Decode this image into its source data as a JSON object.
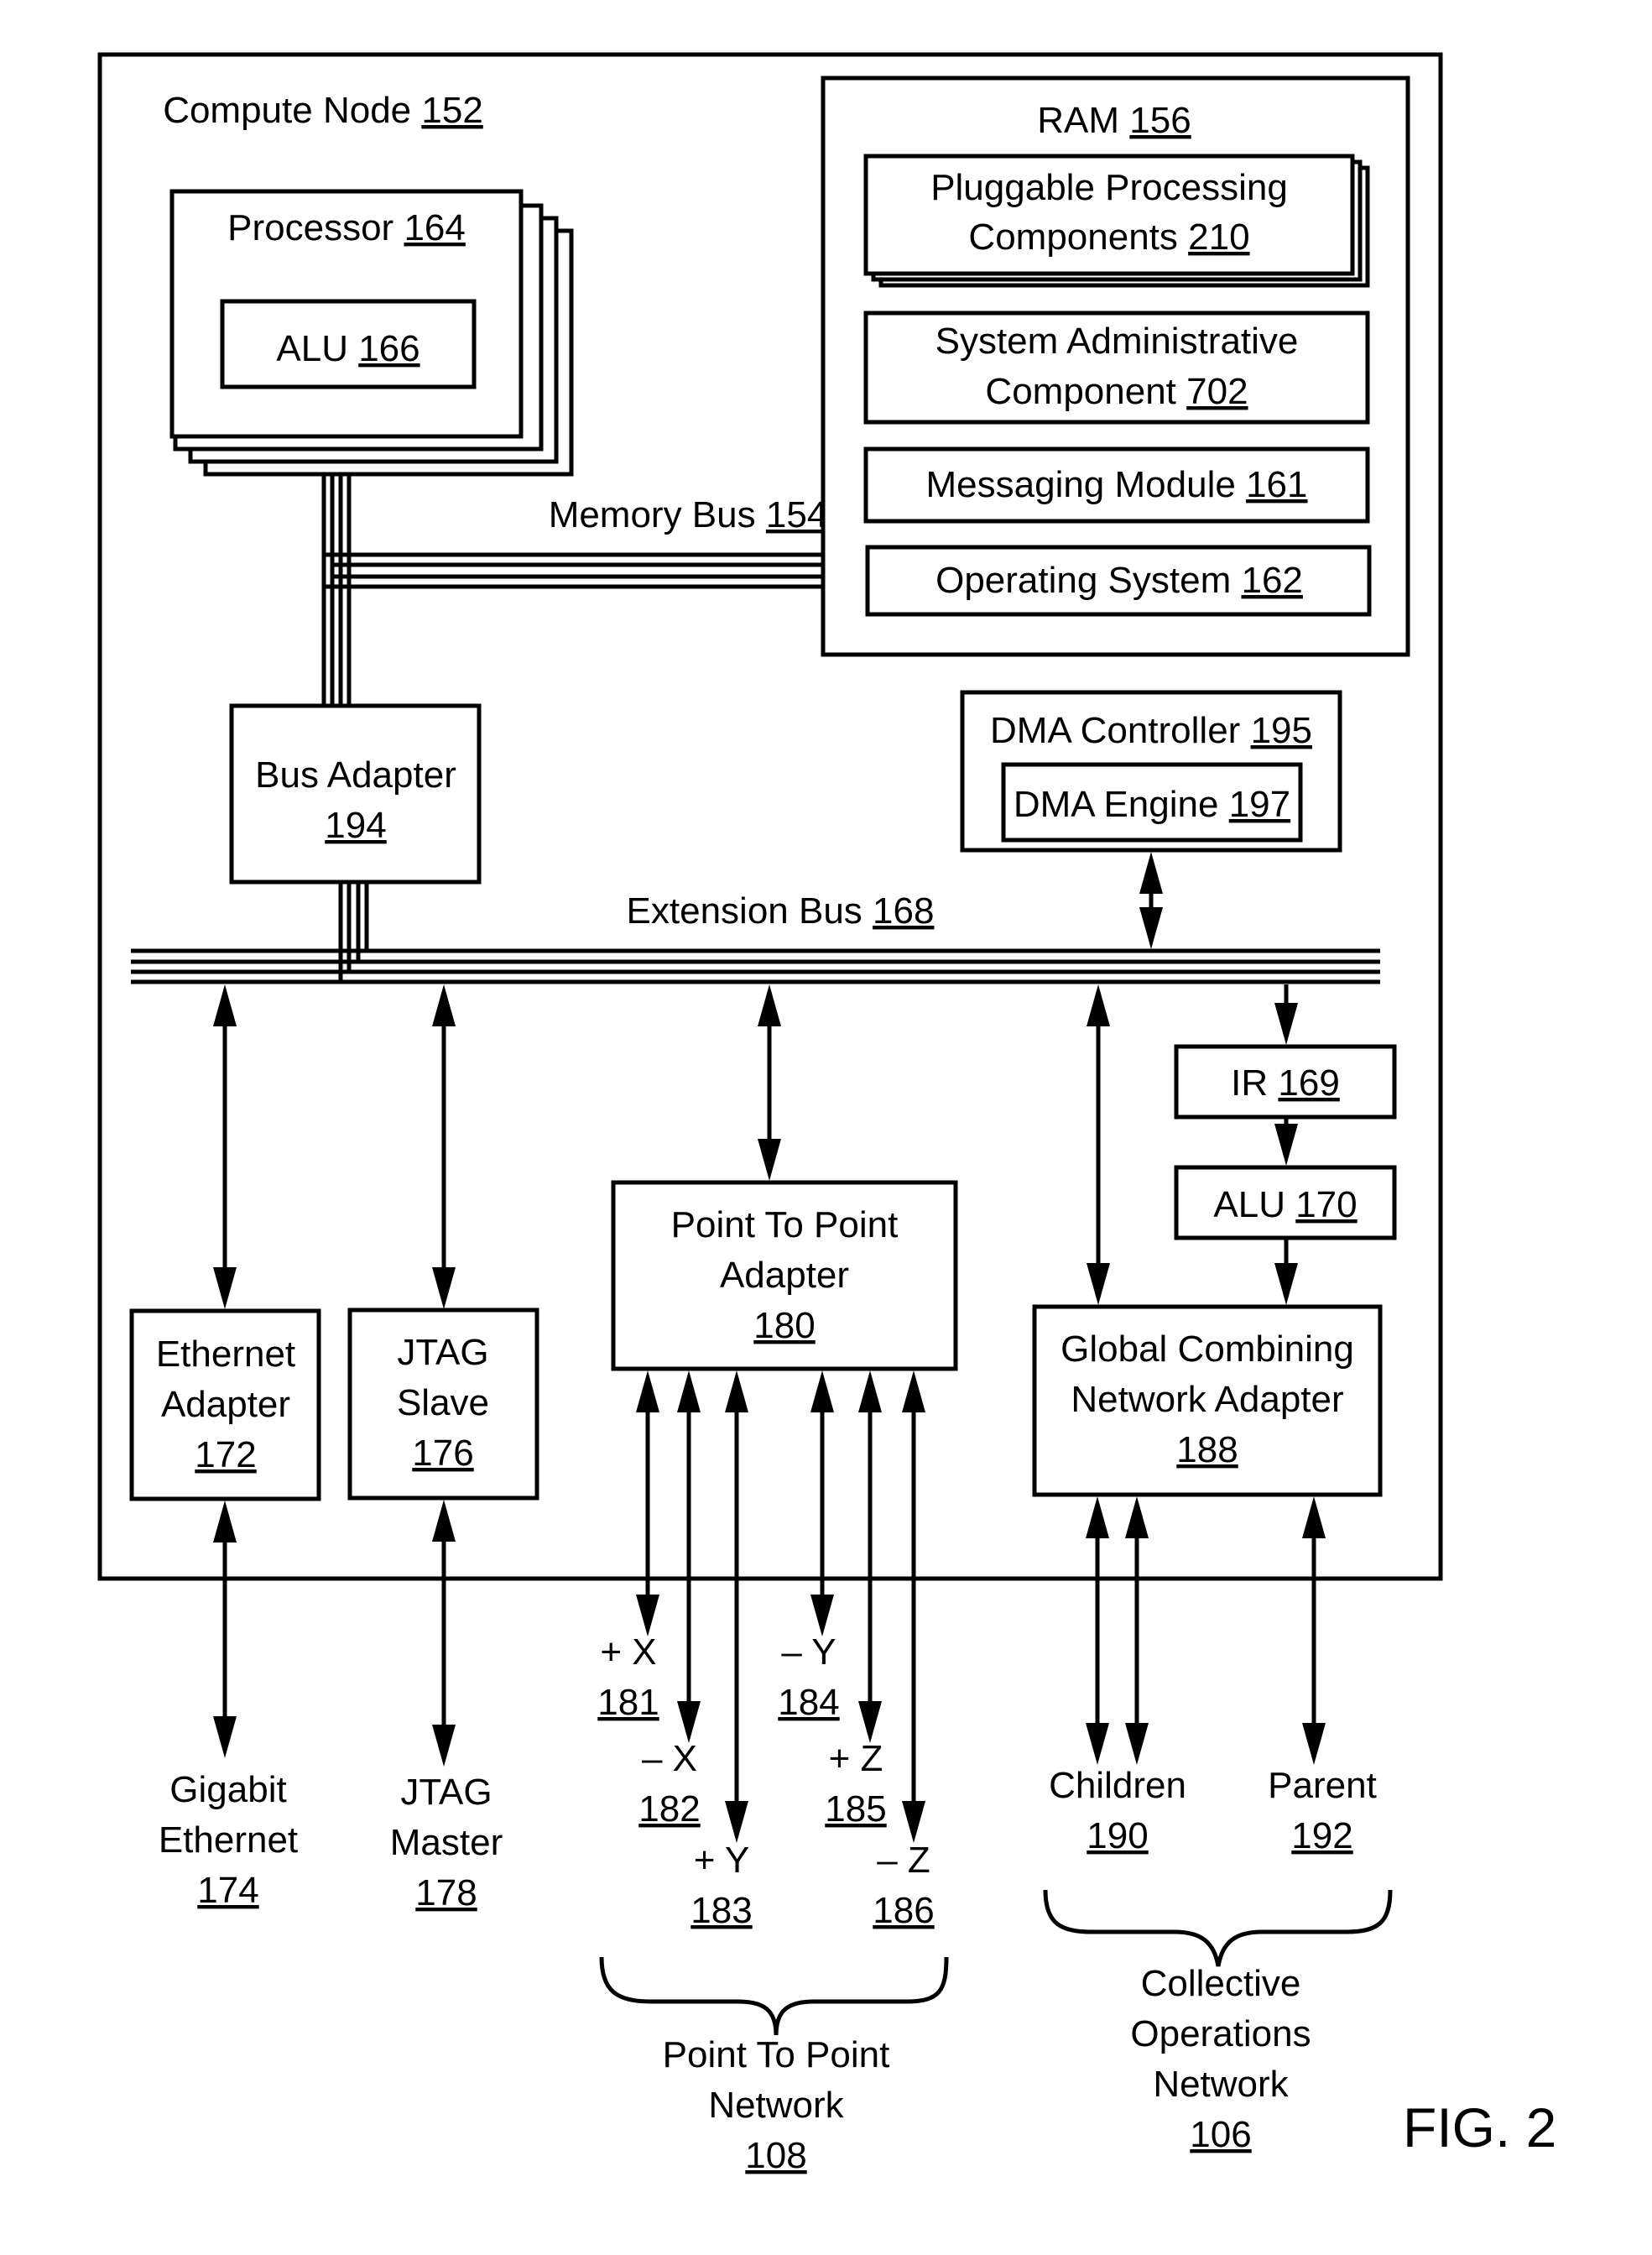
{
  "figure_label": "FIG. 2",
  "compute_node": {
    "name": "Compute Node",
    "ref": "152"
  },
  "processor": {
    "name": "Processor",
    "ref": "164"
  },
  "processor_alu": {
    "name": "ALU",
    "ref": "166"
  },
  "ram": {
    "name": "RAM",
    "ref": "156"
  },
  "ram_items": [
    {
      "line1": "Pluggable Processing",
      "line2": "Components",
      "ref": "210"
    },
    {
      "line1": "System Administrative",
      "line2": "Component",
      "ref": "702"
    },
    {
      "line1": "Messaging Module",
      "ref": "161"
    },
    {
      "line1": "Operating System",
      "ref": "162"
    }
  ],
  "memory_bus": {
    "name": "Memory Bus",
    "ref": "154"
  },
  "bus_adapter": {
    "name": "Bus Adapter",
    "ref": "194"
  },
  "dma_controller": {
    "name": "DMA Controller",
    "ref": "195"
  },
  "dma_engine": {
    "name": "DMA Engine",
    "ref": "197"
  },
  "extension_bus": {
    "name": "Extension Bus",
    "ref": "168"
  },
  "ir": {
    "name": "IR",
    "ref": "169"
  },
  "alu_170": {
    "name": "ALU",
    "ref": "170"
  },
  "ethernet_adapter": {
    "line1": "Ethernet",
    "line2": "Adapter",
    "ref": "172"
  },
  "jtag_slave": {
    "line1": "JTAG",
    "line2": "Slave",
    "ref": "176"
  },
  "ptp_adapter": {
    "line1": "Point To Point",
    "line2": "Adapter",
    "ref": "180"
  },
  "gcn_adapter": {
    "line1": "Global Combining",
    "line2": "Network Adapter",
    "ref": "188"
  },
  "gigabit_ethernet": {
    "line1": "Gigabit",
    "line2": "Ethernet",
    "ref": "174"
  },
  "jtag_master": {
    "line1": "JTAG",
    "line2": "Master",
    "ref": "178"
  },
  "links": [
    {
      "sign": "+",
      "axis": "X",
      "ref": "181"
    },
    {
      "sign": "–",
      "axis": "X",
      "ref": "182"
    },
    {
      "sign": "+",
      "axis": "Y",
      "ref": "183"
    },
    {
      "sign": "–",
      "axis": "Y",
      "ref": "184"
    },
    {
      "sign": "+",
      "axis": "Z",
      "ref": "185"
    },
    {
      "sign": "–",
      "axis": "Z",
      "ref": "186"
    }
  ],
  "children": {
    "name": "Children",
    "ref": "190"
  },
  "parent": {
    "name": "Parent",
    "ref": "192"
  },
  "ptp_network": {
    "line1": "Point To Point",
    "line2": "Network",
    "ref": "108"
  },
  "collective_network": {
    "line1": "Collective",
    "line2": "Operations",
    "line3": "Network",
    "ref": "106"
  }
}
